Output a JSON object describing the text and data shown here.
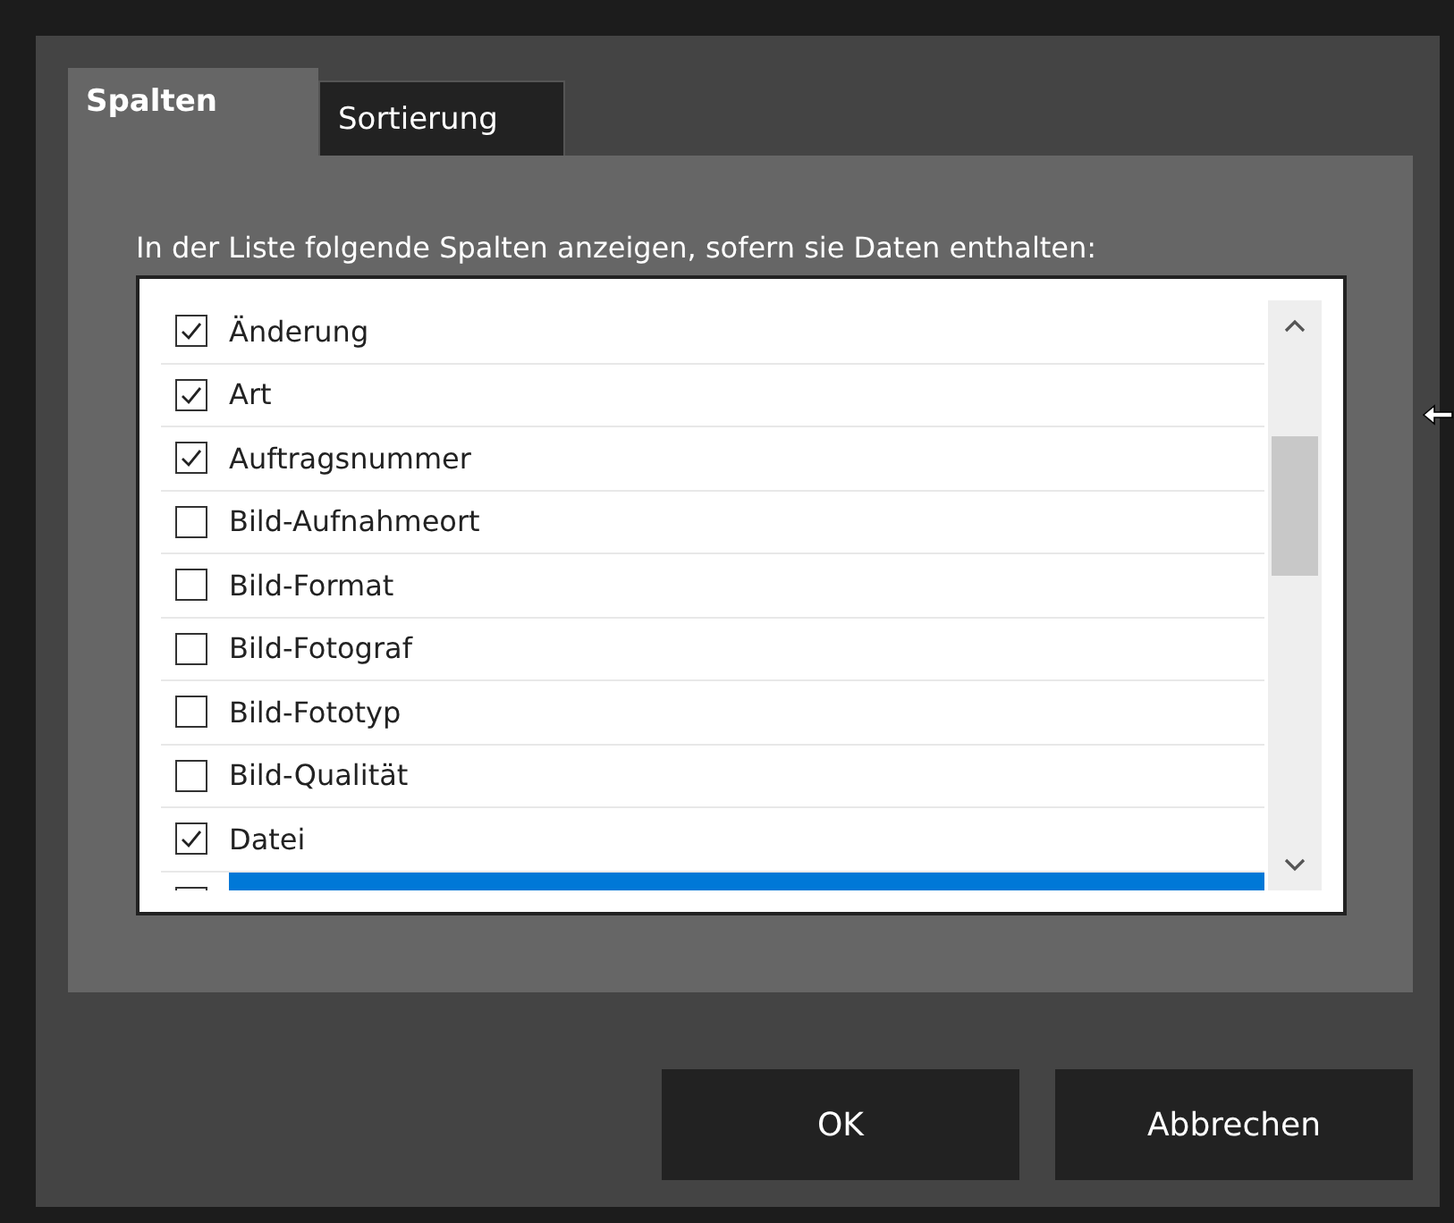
{
  "tabs": [
    {
      "label": "Spalten",
      "selected": true
    },
    {
      "label": "Sortierung",
      "selected": false
    }
  ],
  "instruction": "In der Liste folgende Spalten anzeigen, sofern sie Daten enthalten:",
  "columns": [
    {
      "label": "Änderung",
      "checked": true,
      "selected": false
    },
    {
      "label": "Art",
      "checked": true,
      "selected": false
    },
    {
      "label": "Auftragsnummer",
      "checked": true,
      "selected": false
    },
    {
      "label": "Bild-Aufnahmeort",
      "checked": false,
      "selected": false
    },
    {
      "label": "Bild-Format",
      "checked": false,
      "selected": false
    },
    {
      "label": "Bild-Fotograf",
      "checked": false,
      "selected": false
    },
    {
      "label": "Bild-Fototyp",
      "checked": false,
      "selected": false
    },
    {
      "label": "Bild-Qualität",
      "checked": false,
      "selected": false
    },
    {
      "label": "Datei",
      "checked": true,
      "selected": false
    },
    {
      "selected": true
    }
  ],
  "buttons": [
    {
      "label": "OK"
    },
    {
      "label": "Abbrechen"
    }
  ]
}
